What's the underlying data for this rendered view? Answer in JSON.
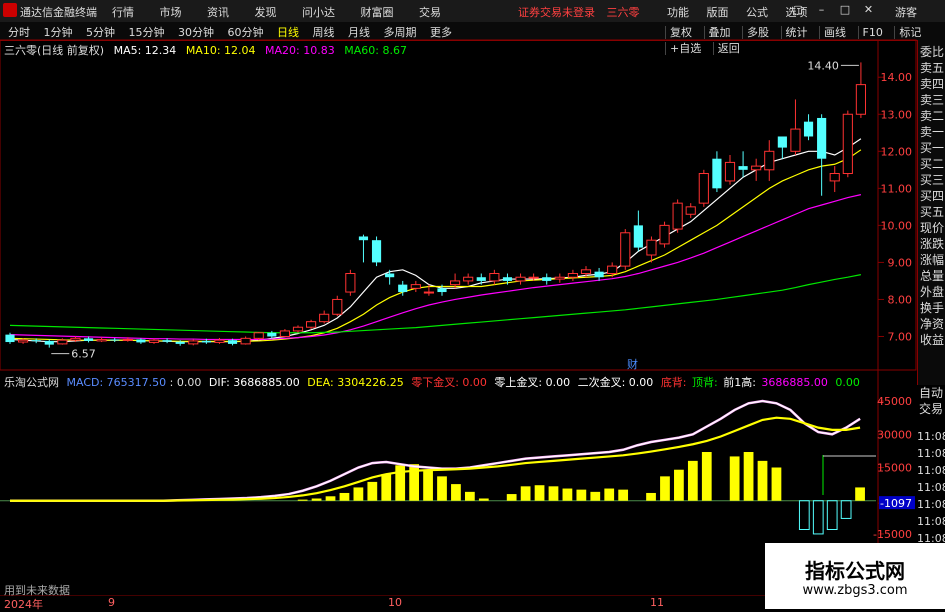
{
  "app": {
    "title": "通达信金融终端",
    "notice": "证券交易未登录",
    "stock": "三六零",
    "guest": "游客"
  },
  "menu": [
    "行情",
    "市场",
    "资讯",
    "发现",
    "问小达",
    "财富圈",
    "交易"
  ],
  "right_menu": [
    "功能",
    "版面",
    "公式",
    "选项"
  ],
  "periods": [
    "分时",
    "1分钟",
    "5分钟",
    "15分钟",
    "30分钟",
    "60分钟",
    "日线",
    "周线",
    "月线",
    "多周期",
    "更多"
  ],
  "active_period": "日线",
  "tools": [
    "复权",
    "叠加",
    "多股",
    "统计",
    "画线",
    "F10",
    "标记",
    "+自选",
    "返回"
  ],
  "ma_header": {
    "name": "三六零(日线 前复权)",
    "ma5": "MA5: 12.34",
    "ma10": "MA10: 12.04",
    "ma20": "MA20: 10.83",
    "ma60": "MA60: 8.67"
  },
  "ind_header": {
    "name": "乐淘公式网",
    "macd": "MACD: 765317.50",
    "v0": ": 0.00",
    "dif": "DIF: 3686885.00",
    "dea": "DEA: 3304226.25",
    "l1": "零下金叉: 0.00",
    "l2": "零上金叉: 0.00",
    "l3": "二次金叉: 0.00",
    "l4": "底背: ",
    "l5": "顶背: ",
    "l6": "前1高: ",
    "l7": "3686885.00",
    "l8": "0.00"
  },
  "right_panel": [
    "委比",
    "卖五",
    "卖四",
    "卖三",
    "卖二",
    "卖一",
    "买一",
    "买二",
    "买三",
    "买四",
    "买五",
    "现价",
    "涨跌",
    "涨幅",
    "总量",
    "外盘",
    "换手",
    "净资",
    "收益"
  ],
  "right_panel2": [
    "自动",
    "交易"
  ],
  "price_axis": [
    "14.00",
    "13.00",
    "12.00",
    "11.00",
    "10.00",
    "9.00",
    "8.00",
    "7.00"
  ],
  "ind_axis": [
    "45000",
    "30000",
    "15000",
    "-1097",
    "-15000"
  ],
  "ind_axis_right": [
    "11:08",
    "11:08",
    "11:08",
    "11:08",
    "11:08",
    "11:08",
    "11:08",
    "11:08"
  ],
  "price_high_label": "14.40",
  "price_low_label": "6.57",
  "cai_label": "财",
  "footer_note": "用到未来数据",
  "time_labels": [
    "2024年",
    "9",
    "10",
    "11"
  ],
  "watermark": {
    "title": "指标公式网",
    "url": "www.zbgs3.com"
  },
  "colors": {
    "up": "#ff3232",
    "down": "#54ffff",
    "ma5": "#ffffff",
    "ma10": "#ffff00",
    "ma20": "#ff00ff",
    "ma60": "#00e600"
  },
  "chart_data": {
    "type": "candlestick",
    "ylim": [
      6.5,
      14.6
    ],
    "candles": [
      [
        7.05,
        6.85,
        7.1,
        6.8
      ],
      [
        6.85,
        6.9,
        6.95,
        6.8
      ],
      [
        6.9,
        6.88,
        6.95,
        6.82
      ],
      [
        6.88,
        6.78,
        6.92,
        6.7
      ],
      [
        6.8,
        6.9,
        6.95,
        6.78
      ],
      [
        6.9,
        6.95,
        7.0,
        6.85
      ],
      [
        6.95,
        6.88,
        7.0,
        6.84
      ],
      [
        6.88,
        6.92,
        6.98,
        6.85
      ],
      [
        6.92,
        6.9,
        6.96,
        6.85
      ],
      [
        6.9,
        6.92,
        6.98,
        6.86
      ],
      [
        6.92,
        6.84,
        6.95,
        6.8
      ],
      [
        6.84,
        6.9,
        6.94,
        6.8
      ],
      [
        6.9,
        6.86,
        6.95,
        6.82
      ],
      [
        6.86,
        6.8,
        6.9,
        6.75
      ],
      [
        6.8,
        6.88,
        6.92,
        6.76
      ],
      [
        6.88,
        6.84,
        6.94,
        6.8
      ],
      [
        6.84,
        6.9,
        6.96,
        6.8
      ],
      [
        6.9,
        6.8,
        6.94,
        6.76
      ],
      [
        6.8,
        6.95,
        7.0,
        6.78
      ],
      [
        6.95,
        7.1,
        7.12,
        6.9
      ],
      [
        7.1,
        7.0,
        7.15,
        6.95
      ],
      [
        7.0,
        7.15,
        7.2,
        6.98
      ],
      [
        7.15,
        7.25,
        7.3,
        7.1
      ],
      [
        7.25,
        7.4,
        7.45,
        7.2
      ],
      [
        7.4,
        7.6,
        7.7,
        7.35
      ],
      [
        7.6,
        8.0,
        8.1,
        7.55
      ],
      [
        8.2,
        8.7,
        8.8,
        8.1
      ],
      [
        9.7,
        9.6,
        9.75,
        9.0
      ],
      [
        9.6,
        9.0,
        9.7,
        8.9
      ],
      [
        8.7,
        8.6,
        8.8,
        8.4
      ],
      [
        8.4,
        8.2,
        8.5,
        8.1
      ],
      [
        8.3,
        8.4,
        8.5,
        8.2
      ],
      [
        8.2,
        8.2,
        8.4,
        8.1
      ],
      [
        8.3,
        8.2,
        8.4,
        8.1
      ],
      [
        8.4,
        8.5,
        8.7,
        8.3
      ],
      [
        8.5,
        8.6,
        8.7,
        8.4
      ],
      [
        8.6,
        8.5,
        8.7,
        8.4
      ],
      [
        8.5,
        8.7,
        8.8,
        8.4
      ],
      [
        8.6,
        8.5,
        8.7,
        8.4
      ],
      [
        8.5,
        8.6,
        8.7,
        8.4
      ],
      [
        8.6,
        8.6,
        8.7,
        8.5
      ],
      [
        8.6,
        8.5,
        8.7,
        8.4
      ],
      [
        8.55,
        8.6,
        8.7,
        8.45
      ],
      [
        8.6,
        8.7,
        8.8,
        8.5
      ],
      [
        8.7,
        8.8,
        8.9,
        8.6
      ],
      [
        8.75,
        8.6,
        8.85,
        8.5
      ],
      [
        8.7,
        8.9,
        9.0,
        8.6
      ],
      [
        8.9,
        9.8,
        9.9,
        8.8
      ],
      [
        10.0,
        9.4,
        10.4,
        9.3
      ],
      [
        9.2,
        9.6,
        9.7,
        9.0
      ],
      [
        9.5,
        10.0,
        10.1,
        9.4
      ],
      [
        9.9,
        10.6,
        10.7,
        9.8
      ],
      [
        10.3,
        10.5,
        10.6,
        10.2
      ],
      [
        10.6,
        11.4,
        11.5,
        10.5
      ],
      [
        11.8,
        11.0,
        12.0,
        10.9
      ],
      [
        11.2,
        11.7,
        11.9,
        11.1
      ],
      [
        11.6,
        11.5,
        12.0,
        11.3
      ],
      [
        11.5,
        11.6,
        11.8,
        11.2
      ],
      [
        11.5,
        12.0,
        12.3,
        11.2
      ],
      [
        12.4,
        12.1,
        12.4,
        11.8
      ],
      [
        12.0,
        12.6,
        13.4,
        11.9
      ],
      [
        12.8,
        12.4,
        13.0,
        12.3
      ],
      [
        12.9,
        11.8,
        13.0,
        10.8
      ],
      [
        11.2,
        11.4,
        11.6,
        10.9
      ],
      [
        11.4,
        13.0,
        13.1,
        11.3
      ],
      [
        13.0,
        13.8,
        14.4,
        12.9
      ]
    ],
    "ma_series": [
      {
        "name": "MA5",
        "color": "#ffffff",
        "values": [
          6.92,
          6.9,
          6.88,
          6.86,
          6.86,
          6.88,
          6.9,
          6.9,
          6.9,
          6.9,
          6.89,
          6.88,
          6.87,
          6.86,
          6.86,
          6.86,
          6.86,
          6.86,
          6.87,
          6.9,
          6.95,
          7.0,
          7.08,
          7.18,
          7.3,
          7.5,
          7.8,
          8.2,
          8.6,
          8.75,
          8.8,
          8.65,
          8.4,
          8.3,
          8.3,
          8.35,
          8.45,
          8.5,
          8.55,
          8.55,
          8.55,
          8.56,
          8.58,
          8.6,
          8.65,
          8.68,
          8.75,
          9.0,
          9.3,
          9.5,
          9.7,
          9.9,
          10.1,
          10.4,
          10.7,
          11.0,
          11.3,
          11.5,
          11.7,
          11.8,
          11.9,
          12.0,
          12.0,
          11.9,
          12.1,
          12.34
        ]
      },
      {
        "name": "MA10",
        "color": "#ffff00",
        "values": [
          6.95,
          6.94,
          6.93,
          6.92,
          6.91,
          6.9,
          6.9,
          6.9,
          6.9,
          6.9,
          6.89,
          6.88,
          6.88,
          6.87,
          6.87,
          6.87,
          6.87,
          6.87,
          6.87,
          6.88,
          6.9,
          6.93,
          6.97,
          7.02,
          7.1,
          7.22,
          7.4,
          7.6,
          7.85,
          8.05,
          8.2,
          8.3,
          8.35,
          8.35,
          8.35,
          8.35,
          8.35,
          8.4,
          8.45,
          8.5,
          8.52,
          8.54,
          8.56,
          8.58,
          8.6,
          8.62,
          8.65,
          8.75,
          8.9,
          9.05,
          9.2,
          9.4,
          9.6,
          9.8,
          10.0,
          10.25,
          10.5,
          10.75,
          11.0,
          11.2,
          11.35,
          11.5,
          11.6,
          11.65,
          11.8,
          12.04
        ]
      },
      {
        "name": "MA20",
        "color": "#ff00ff",
        "values": [
          7.05,
          7.04,
          7.03,
          7.02,
          7.01,
          7.0,
          6.99,
          6.98,
          6.97,
          6.96,
          6.95,
          6.94,
          6.94,
          6.93,
          6.93,
          6.92,
          6.92,
          6.92,
          6.92,
          6.92,
          6.93,
          6.95,
          6.97,
          7.0,
          7.04,
          7.1,
          7.18,
          7.28,
          7.4,
          7.52,
          7.64,
          7.75,
          7.85,
          7.93,
          8.0,
          8.06,
          8.12,
          8.17,
          8.22,
          8.27,
          8.32,
          8.36,
          8.4,
          8.44,
          8.48,
          8.52,
          8.56,
          8.62,
          8.7,
          8.8,
          8.9,
          9.0,
          9.12,
          9.25,
          9.4,
          9.55,
          9.7,
          9.85,
          10.0,
          10.15,
          10.3,
          10.45,
          10.55,
          10.65,
          10.75,
          10.83
        ]
      },
      {
        "name": "MA60",
        "color": "#00e600",
        "values": [
          7.3,
          7.29,
          7.28,
          7.27,
          7.26,
          7.25,
          7.24,
          7.23,
          7.22,
          7.21,
          7.2,
          7.19,
          7.18,
          7.17,
          7.16,
          7.15,
          7.14,
          7.13,
          7.12,
          7.11,
          7.1,
          7.1,
          7.1,
          7.1,
          7.11,
          7.12,
          7.14,
          7.16,
          7.18,
          7.2,
          7.22,
          7.24,
          7.27,
          7.3,
          7.33,
          7.36,
          7.39,
          7.42,
          7.45,
          7.48,
          7.51,
          7.54,
          7.57,
          7.6,
          7.63,
          7.66,
          7.69,
          7.72,
          7.76,
          7.8,
          7.84,
          7.88,
          7.92,
          7.96,
          8.0,
          8.05,
          8.1,
          8.15,
          8.2,
          8.25,
          8.32,
          8.4,
          8.47,
          8.54,
          8.6,
          8.67
        ]
      }
    ],
    "macd": {
      "ylim": [
        -20000,
        50000
      ],
      "bars": [
        0,
        0,
        0,
        0,
        0,
        0,
        0,
        0,
        0,
        0,
        0,
        0,
        0,
        0,
        0,
        0,
        0,
        0,
        0,
        0,
        0,
        500,
        1000,
        2000,
        3500,
        6000,
        8500,
        12000,
        16000,
        16500,
        14000,
        11000,
        7500,
        4000,
        1000,
        0,
        3000,
        6500,
        7000,
        6500,
        5500,
        5000,
        4000,
        5500,
        5000,
        0,
        3500,
        11000,
        14000,
        18000,
        22000,
        0,
        20000,
        22000,
        18000,
        15000,
        0,
        -13000,
        -15000,
        -13000,
        -8000,
        6000
      ],
      "dif": [
        0,
        0,
        0,
        0,
        0,
        0,
        0,
        0,
        0,
        0,
        0,
        0,
        200,
        400,
        600,
        800,
        1000,
        1200,
        1600,
        2200,
        3000,
        4500,
        6500,
        9000,
        12000,
        15000,
        17000,
        17500,
        16500,
        15500,
        15000,
        14500,
        14500,
        15000,
        16000,
        17000,
        18000,
        19000,
        19500,
        20000,
        20500,
        21000,
        21500,
        22000,
        23000,
        25000,
        26500,
        27500,
        28500,
        30000,
        33500,
        37000,
        41000,
        44000,
        45000,
        44000,
        41000,
        35000,
        31000,
        30000,
        33000,
        37000
      ],
      "dea": [
        0,
        0,
        0,
        0,
        0,
        0,
        0,
        0,
        0,
        0,
        0,
        0,
        100,
        200,
        300,
        400,
        500,
        700,
        900,
        1200,
        1700,
        2400,
        3400,
        4800,
        6500,
        8500,
        10500,
        12000,
        13000,
        13500,
        13800,
        14000,
        14200,
        14500,
        15000,
        15500,
        16200,
        17000,
        17500,
        18000,
        18500,
        19000,
        19500,
        20000,
        20500,
        21300,
        22200,
        23200,
        24300,
        25500,
        27000,
        29000,
        31500,
        34000,
        36500,
        37500,
        37000,
        35000,
        33000,
        32000,
        32000,
        33000
      ]
    }
  }
}
